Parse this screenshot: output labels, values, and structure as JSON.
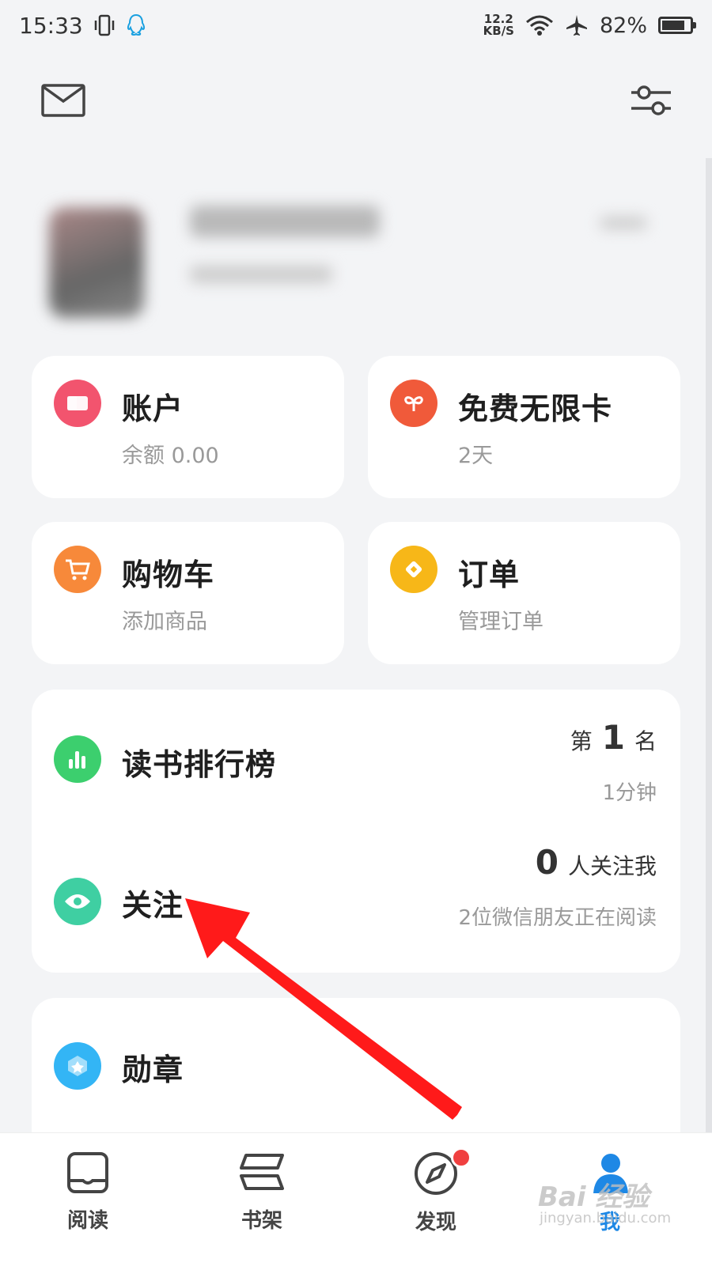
{
  "status_bar": {
    "time": "15:33",
    "net_speed_value": "12.2",
    "net_speed_unit": "KB/S",
    "battery_percent": "82%",
    "battery_level": 0.82
  },
  "cards": {
    "account": {
      "title": "账户",
      "subtitle": "余额 0.00",
      "icon": "wallet-icon",
      "color": "#f2546e"
    },
    "free_card": {
      "title": "免费无限卡",
      "subtitle": "2天",
      "icon": "infinity-card-icon",
      "color": "#f05a3a"
    },
    "cart": {
      "title": "购物车",
      "subtitle": "添加商品",
      "icon": "cart-icon",
      "color": "#f7893a"
    },
    "orders": {
      "title": "订单",
      "subtitle": "管理订单",
      "icon": "order-icon",
      "color": "#f7b718"
    }
  },
  "ranking": {
    "title": "读书排行榜",
    "prefix": "第",
    "rank": "1",
    "suffix": "名",
    "time": "1分钟",
    "color": "#3ccf6e"
  },
  "follow": {
    "title": "关注",
    "count": "0",
    "count_label": "人关注我",
    "friends_text": "2位微信朋友正在阅读",
    "color": "#3fcfa2"
  },
  "medal": {
    "title": "勋章",
    "color": "#33b5f5"
  },
  "tabs": [
    {
      "label": "阅读"
    },
    {
      "label": "书架"
    },
    {
      "label": "发现"
    },
    {
      "label": "我"
    }
  ],
  "watermark": {
    "brand": "Bai 经验",
    "url": "jingyan.baidu.com"
  },
  "annotation_color": "#ff1a1a"
}
